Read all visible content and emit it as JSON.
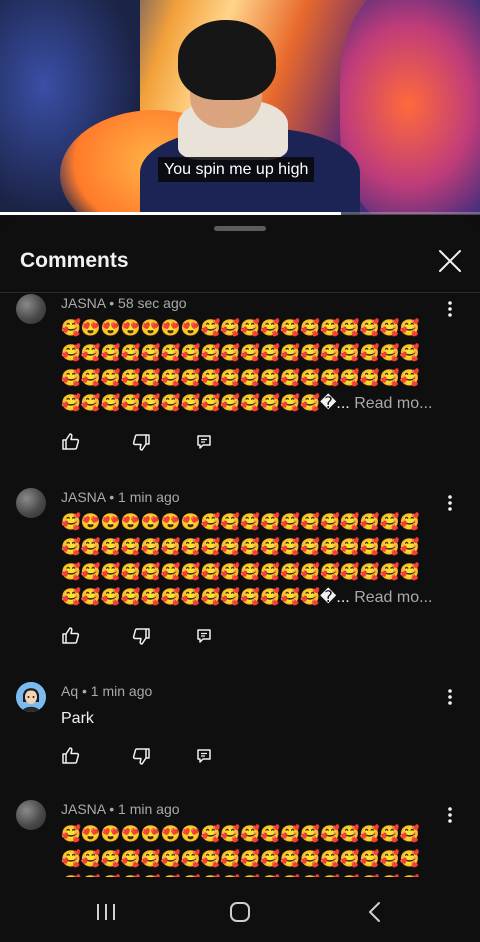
{
  "video": {
    "caption": "You spin me up high",
    "progress": 0.71
  },
  "comments_panel": {
    "title": "Comments",
    "close_icon": "close-icon"
  },
  "comments": [
    {
      "author": "JASNA",
      "time": "58 sec ago",
      "meta": "JASNA • 58 sec ago",
      "avatar": "avatar-gray",
      "lines": [
        "🥰😍😍😍😍😍😍🥰🥰🥰🥰🥰🥰🥰🥰🥰🥰🥰",
        "🥰🥰🥰🥰🥰🥰🥰🥰🥰🥰🥰🥰🥰🥰🥰🥰🥰🥰",
        "🥰🥰🥰🥰🥰🥰🥰🥰🥰🥰🥰🥰🥰🥰🥰🥰🥰🥰",
        "🥰🥰🥰🥰🥰🥰🥰🥰🥰🥰🥰🥰🥰�..."
      ],
      "read_more": "Read mo..."
    },
    {
      "author": "JASNA",
      "time": "1 min ago",
      "meta": "JASNA • 1 min ago",
      "avatar": "avatar-gray",
      "lines": [
        "🥰😍😍😍😍😍😍🥰🥰🥰🥰🥰🥰🥰🥰🥰🥰🥰",
        "🥰🥰🥰🥰🥰🥰🥰🥰🥰🥰🥰🥰🥰🥰🥰🥰🥰🥰",
        "🥰🥰🥰🥰🥰🥰🥰🥰🥰🥰🥰🥰🥰🥰🥰🥰🥰🥰",
        "🥰🥰🥰🥰🥰🥰🥰🥰🥰🥰🥰🥰🥰�..."
      ],
      "read_more": "Read mo..."
    },
    {
      "author": "Aq",
      "time": "1 min ago",
      "meta": "Aq • 1 min ago",
      "avatar": "avatar-cartoon",
      "text": "Park"
    },
    {
      "author": "JASNA",
      "time": "1 min ago",
      "meta": "JASNA • 1 min ago",
      "avatar": "avatar-gray",
      "lines": [
        "🥰😍😍😍😍😍😍🥰🥰🥰🥰🥰🥰🥰🥰🥰🥰🥰",
        "🥰🥰🥰🥰🥰🥰🥰🥰🥰🥰🥰🥰🥰🥰🥰🥰🥰🥰",
        "🥰🥰🥰🥰🥰🥰🥰🥰🥰🥰🥰🥰🥰🥰🥰🥰🥰🥰"
      ]
    }
  ],
  "actions": [
    "thumbs-up-icon",
    "thumbs-down-icon",
    "reply-icon"
  ],
  "navbar": [
    "recent-apps-icon",
    "home-icon",
    "back-icon"
  ],
  "colors": {
    "background": "#0f0f0f",
    "text": "#f1f1f1",
    "secondary_text": "#aaaaaa"
  }
}
